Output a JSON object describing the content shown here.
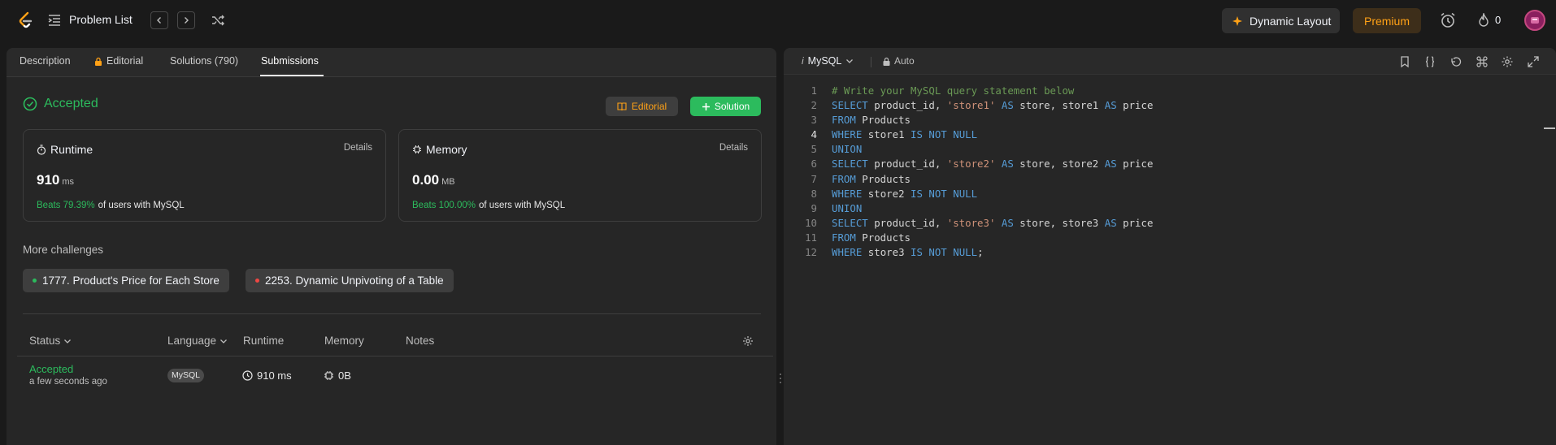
{
  "topbar": {
    "problem_list": "Problem List",
    "dynamic_layout": "Dynamic Layout",
    "premium": "Premium",
    "streak_count": "0"
  },
  "left": {
    "tabs": [
      "Description",
      "Editorial",
      "Solutions (790)",
      "Submissions"
    ],
    "status": "Accepted",
    "editorial_btn": "Editorial",
    "solution_btn": "Solution",
    "runtime": {
      "title": "Runtime",
      "details": "Details",
      "value": "910",
      "unit": "ms",
      "beats": "Beats 79.39%",
      "suffix": "of users with MySQL"
    },
    "memory": {
      "title": "Memory",
      "details": "Details",
      "value": "0.00",
      "unit": "MB",
      "beats": "Beats 100.00%",
      "suffix": "of users with MySQL"
    },
    "more_challenges": "More challenges",
    "challenges": [
      {
        "label": "1777. Product's Price for Each Store",
        "color": "#2cbb5d"
      },
      {
        "label": "2253. Dynamic Unpivoting of a Table",
        "color": "#ef4743"
      }
    ],
    "table": {
      "headers": [
        "Status",
        "Language",
        "Runtime",
        "Memory",
        "Notes"
      ],
      "row": {
        "status": "Accepted",
        "time": "a few seconds ago",
        "language": "MySQL",
        "runtime": "910 ms",
        "memory": "0B"
      }
    }
  },
  "editor": {
    "language": "MySQL",
    "mode": "Auto",
    "lines": [
      "# Write your MySQL query statement below",
      "SELECT product_id, 'store1' AS store, store1 AS price",
      "FROM Products",
      "WHERE store1 IS NOT NULL",
      "UNION",
      "SELECT product_id, 'store2' AS store, store2 AS price",
      "FROM Products",
      "WHERE store2 IS NOT NULL",
      "UNION",
      "SELECT product_id, 'store3' AS store, store3 AS price",
      "FROM Products",
      "WHERE store3 IS NOT NULL;"
    ],
    "line_numbers": [
      "1",
      "2",
      "3",
      "4",
      "5",
      "6",
      "7",
      "8",
      "9",
      "10",
      "11",
      "12"
    ]
  }
}
